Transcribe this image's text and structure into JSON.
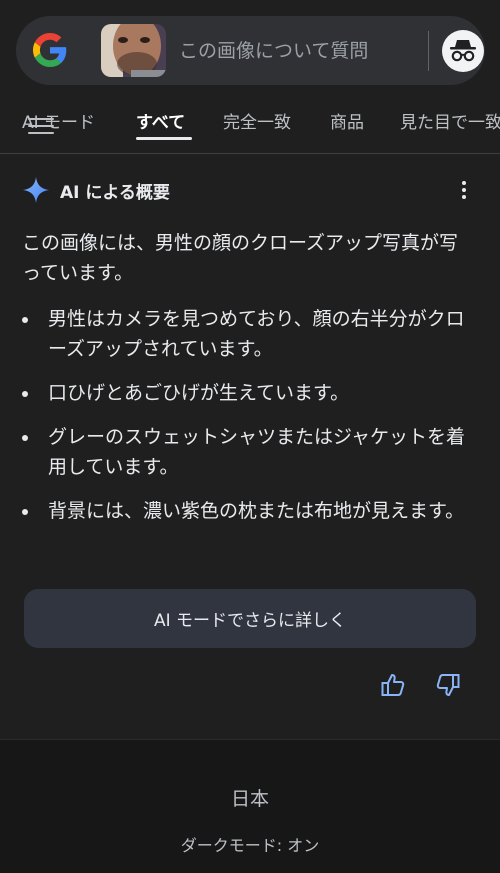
{
  "search": {
    "placeholder": "この画像について質問"
  },
  "tabs": [
    {
      "label": "AI モード"
    },
    {
      "label": "すべて"
    },
    {
      "label": "完全一致"
    },
    {
      "label": "商品"
    },
    {
      "label": "見た目で一致"
    }
  ],
  "ai_overview": {
    "title": "AI による概要",
    "summary": "この画像には、男性の顔のクローズアップ写真が写っています。",
    "bullets": [
      "男性はカメラを見つめており、顔の右半分がクローズアップされています。",
      "口ひげとあごひげが生えています。",
      "グレーのスウェットシャツまたはジャケットを着用しています。",
      "背景には、濃い紫色の枕または布地が見えます。"
    ],
    "more_button": "AI モードでさらに詳しく"
  },
  "footer": {
    "country": "日本",
    "dark_mode": "ダークモード: オン"
  },
  "colors": {
    "background": "#1f1f1f",
    "search_bar": "#303134",
    "ai_button": "#303540",
    "accent_blue": "#8ab4f8"
  }
}
